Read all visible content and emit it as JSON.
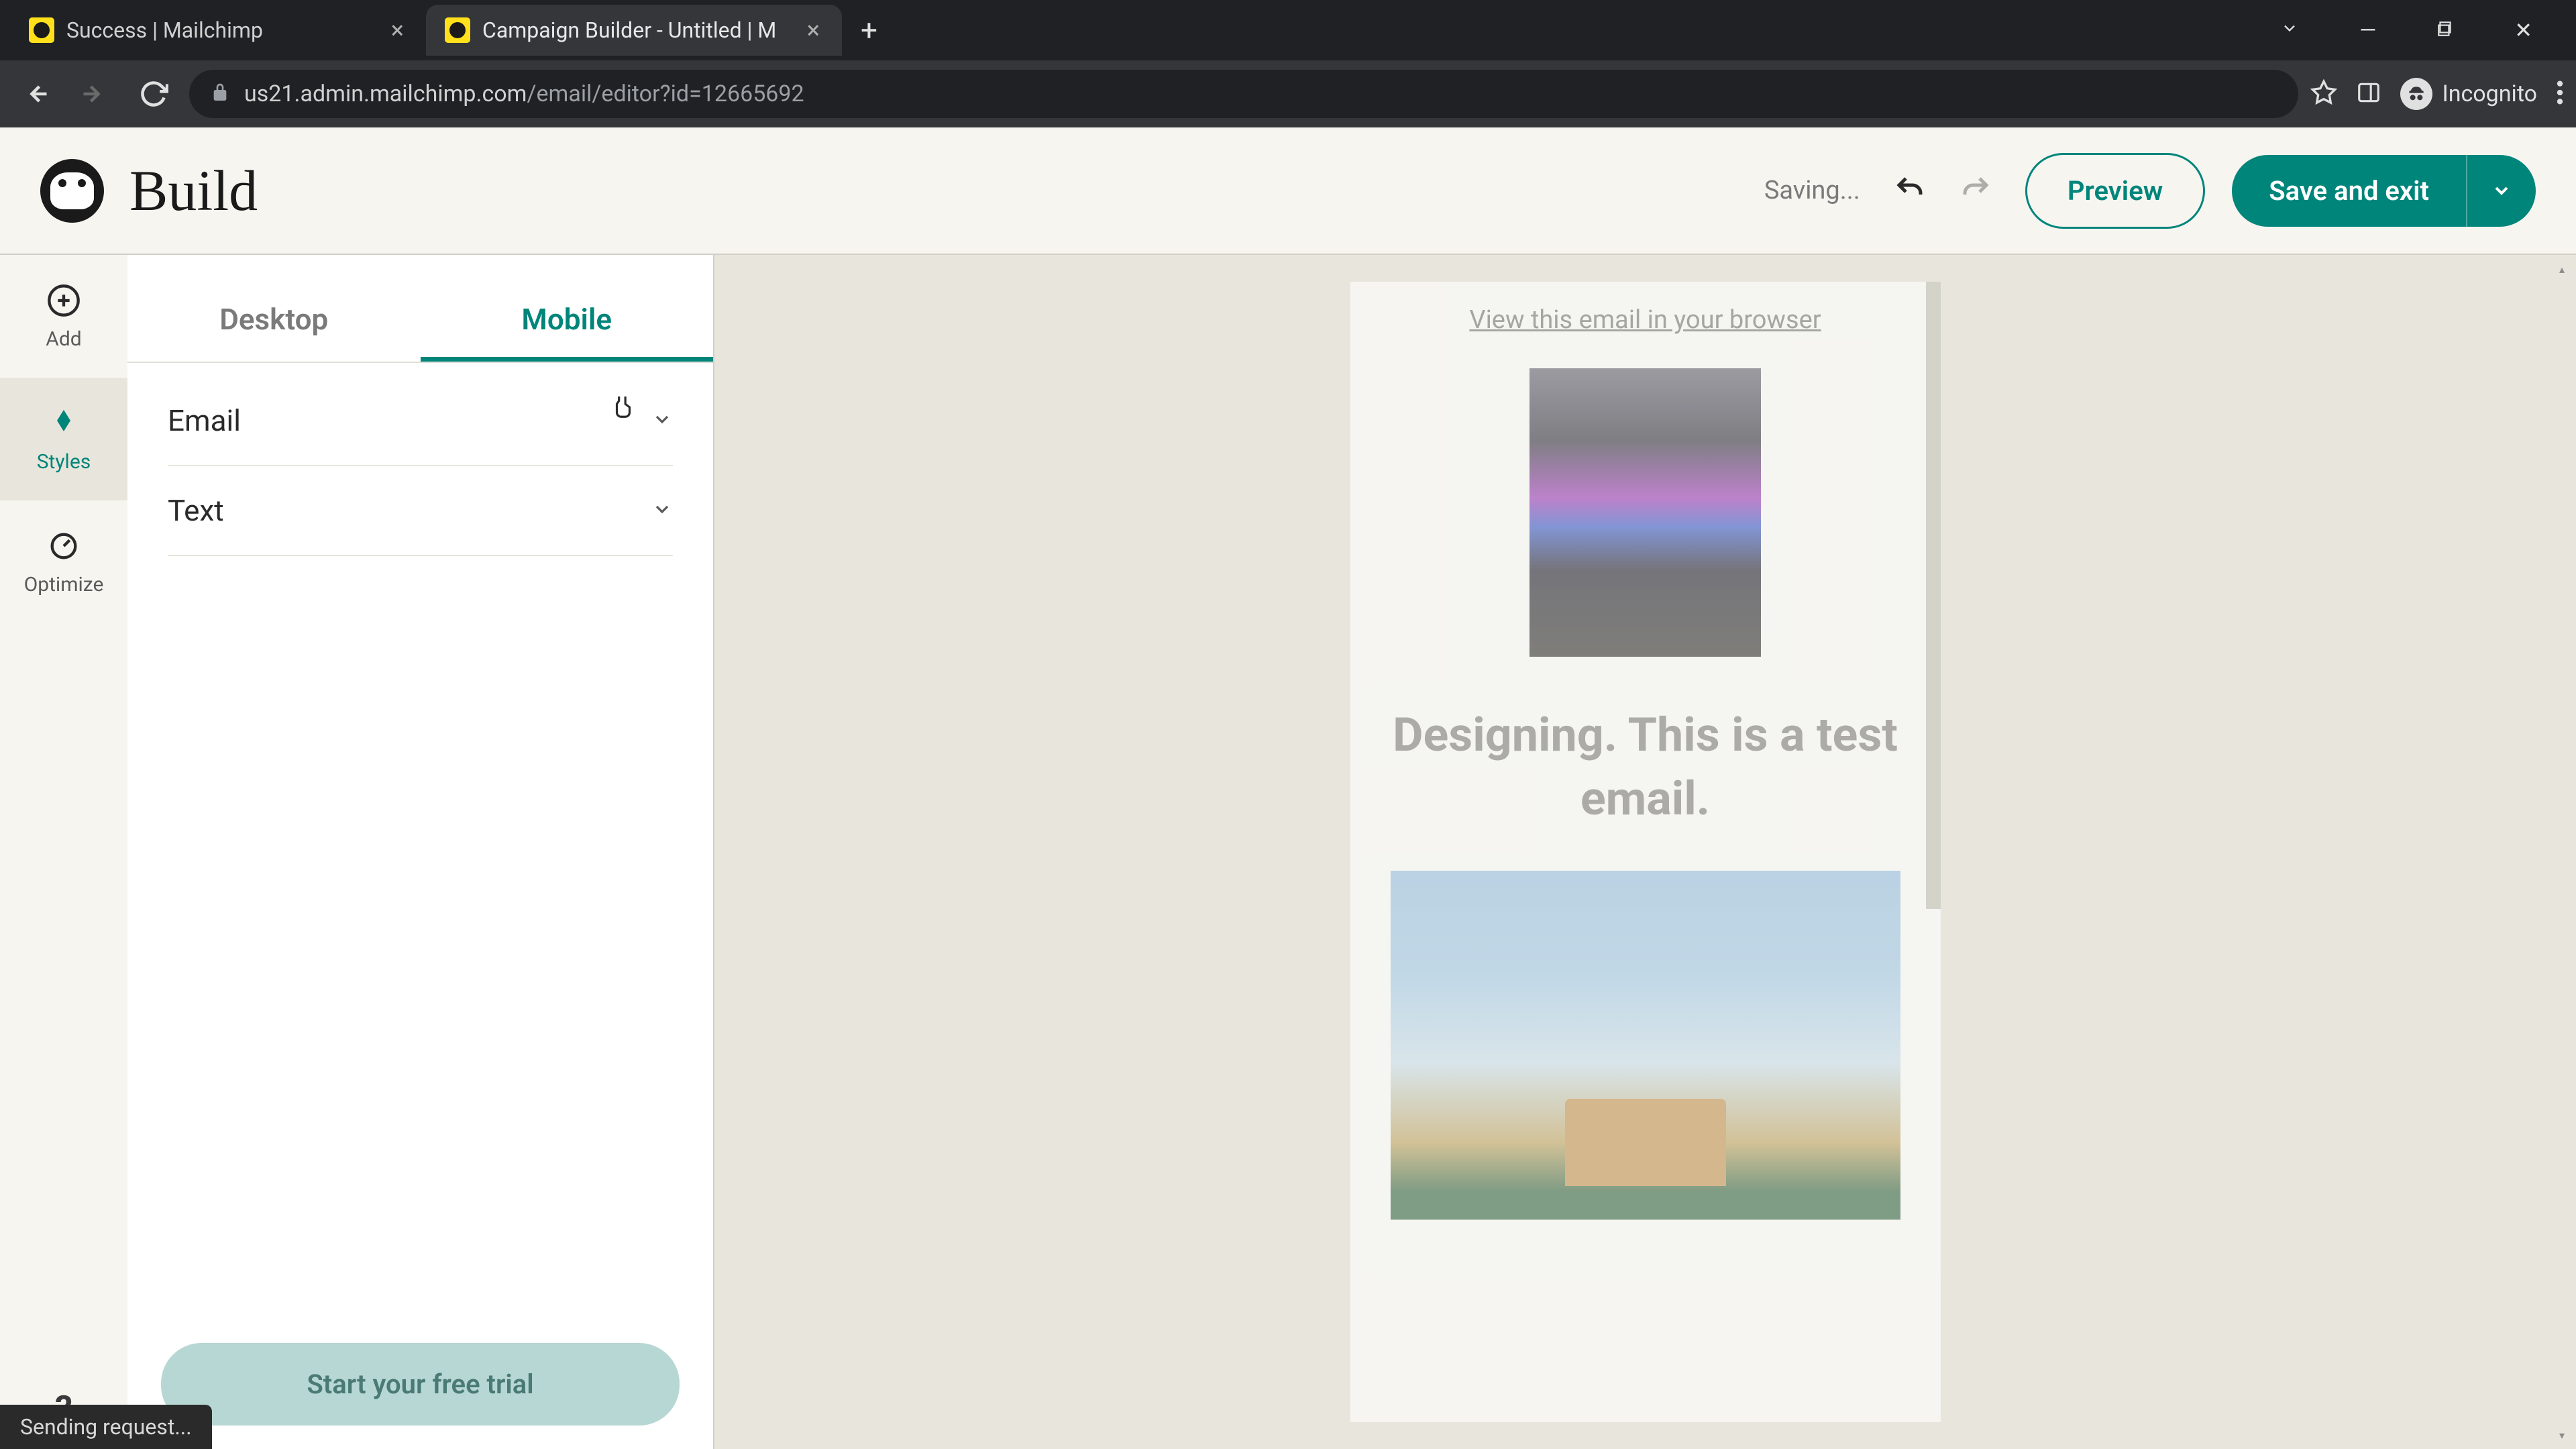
{
  "browser": {
    "tabs": [
      {
        "title": "Success | Mailchimp",
        "active": false
      },
      {
        "title": "Campaign Builder - Untitled | M",
        "active": true
      }
    ],
    "url_host": "us21.admin.mailchimp.com",
    "url_path": "/email/editor?id=12665692",
    "incognito_label": "Incognito",
    "window_controls": {
      "minimize": "—",
      "maximize": "▢",
      "close": "✕"
    }
  },
  "topbar": {
    "title": "Build",
    "saving_label": "Saving...",
    "preview_label": "Preview",
    "save_exit_label": "Save and exit"
  },
  "rail": {
    "items": [
      {
        "id": "add",
        "label": "Add"
      },
      {
        "id": "styles",
        "label": "Styles"
      },
      {
        "id": "optimize",
        "label": "Optimize"
      }
    ],
    "help_icon": "?"
  },
  "side_panel": {
    "tabs": [
      {
        "id": "desktop",
        "label": "Desktop",
        "active": false
      },
      {
        "id": "mobile",
        "label": "Mobile",
        "active": true
      }
    ],
    "sections": [
      {
        "label": "Email"
      },
      {
        "label": "Text"
      }
    ],
    "trial_button": "Start your free trial"
  },
  "email_preview": {
    "view_browser": "View this email in your browser",
    "heading": "Designing. This is a test email."
  },
  "status_bar": "Sending request...",
  "colors": {
    "accent": "#00857b",
    "bg": "#f6f5f0",
    "canvas_bg": "#e8e6dc"
  }
}
